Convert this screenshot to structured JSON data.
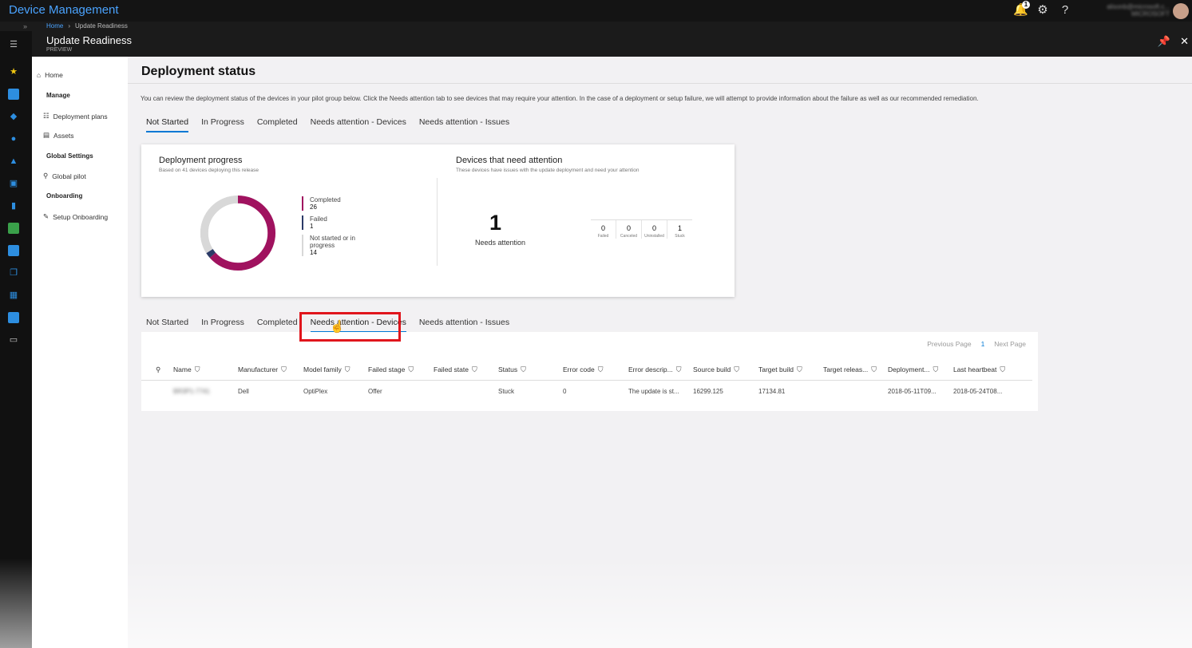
{
  "app": {
    "title": "Device Management"
  },
  "topbar": {
    "notification_count": "1",
    "user_line1": "alisonb@microsoft.c...",
    "user_line2": "MICROSOFT"
  },
  "breadcrumb": {
    "home": "Home",
    "current": "Update Readiness"
  },
  "blade": {
    "title": "Update Readiness",
    "subtitle": "PREVIEW"
  },
  "nav": {
    "home": "Home",
    "manage_header": "Manage",
    "deployment_plans": "Deployment plans",
    "assets": "Assets",
    "global_settings_header": "Global Settings",
    "global_pilot": "Global pilot",
    "onboarding_header": "Onboarding",
    "setup_onboarding": "Setup Onboarding"
  },
  "page": {
    "title": "Deployment status",
    "intro": "You can review the deployment status of the devices in your pilot group below. Click the Needs attention tab to see devices that may require your attention. In the case of a deployment or setup failure, we will attempt to provide information about the failure as well as our recommended remediation."
  },
  "tabs_top": [
    "Not Started",
    "In Progress",
    "Completed",
    "Needs attention - Devices",
    "Needs attention - Issues"
  ],
  "tabs_bottom": [
    "Not Started",
    "In Progress",
    "Completed",
    "Needs attention - Devices",
    "Needs attention - Issues"
  ],
  "progress": {
    "title": "Deployment progress",
    "subtitle": "Based on 41 devices deploying this release",
    "legend": [
      {
        "label": "Completed",
        "value": "26",
        "color": "#a0125f"
      },
      {
        "label": "Failed",
        "value": "1",
        "color": "#2b3a67"
      },
      {
        "label": "Not started or in progress",
        "value": "14",
        "color": "#d8d8d8"
      }
    ]
  },
  "attention": {
    "title": "Devices that need attention",
    "subtitle": "These devices have issues with the update deployment and need your attention",
    "count": "1",
    "count_label": "Needs attention",
    "metrics": [
      {
        "value": "0",
        "label": "Failed"
      },
      {
        "value": "0",
        "label": "Canceled"
      },
      {
        "value": "0",
        "label": "Uninstalled"
      },
      {
        "value": "1",
        "label": "Stuck"
      }
    ]
  },
  "pager": {
    "previous": "Previous Page",
    "current": "1",
    "next": "Next Page"
  },
  "table": {
    "columns": [
      "Name",
      "Manufacturer",
      "Model family",
      "Failed stage",
      "Failed state",
      "Status",
      "Error code",
      "Error descrip...",
      "Source build",
      "Target build",
      "Target releas...",
      "Deployment...",
      "Last heartbeat"
    ],
    "rows": [
      [
        "BR3P1-7741",
        "Dell",
        "OptiPlex",
        "Offer",
        "",
        "Stuck",
        "0",
        "The update is st...",
        "16299.125",
        "17134.81",
        "",
        "2018-05-11T09...",
        "2018-05-24T08..."
      ]
    ]
  }
}
